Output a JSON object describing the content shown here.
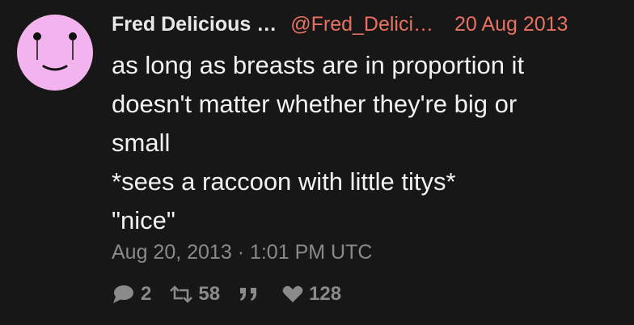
{
  "tweet": {
    "author_name": "Fred Delicious …",
    "author_handle": "@Fred_Delici…",
    "date_short": "20 Aug 2013",
    "content_lines": [
      "as long as breasts are in proportion it",
      "doesn't matter whether they're big or",
      "small",
      "*sees a raccoon with little titys*",
      "\"nice\""
    ],
    "timestamp": "Aug 20, 2013 · 1:01 PM UTC",
    "stats": {
      "replies": "2",
      "retweets": "58",
      "quotes": "",
      "likes": "128"
    }
  },
  "colors": {
    "background": "#171717",
    "accent": "#e8715f",
    "avatar_pink": "#f3b3ef",
    "muted": "#8a8a8a"
  },
  "icons": {
    "reply": "comment-icon",
    "retweet": "retweet-icon",
    "quote": "quote-icon",
    "like": "heart-icon"
  }
}
